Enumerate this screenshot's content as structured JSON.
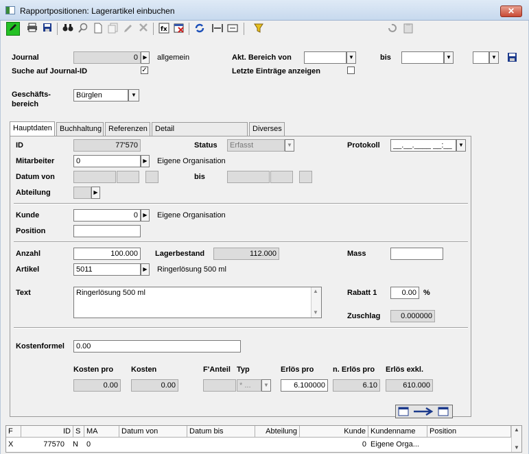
{
  "window": {
    "title": "Rapportpositionen: Lagerartikel einbuchen",
    "close_glyph": "✕"
  },
  "toolbar": {
    "left_icons": [
      "pencil-icon",
      "printer-icon",
      "save-icon",
      "binoculars-icon",
      "zoom-icon",
      "new-page-icon",
      "copy-page-icon",
      "edit-icon",
      "delete-icon",
      "fx-icon",
      "calendar-delete-icon",
      "refresh-icon",
      "resize-icon",
      "fit-icon",
      "filter-funnel-icon"
    ],
    "right_icons": [
      "undo-icon",
      "clipboard-icon"
    ]
  },
  "header": {
    "journal_label": "Journal",
    "journal_value": "0",
    "journal_desc": "allgemein",
    "search_journal_label": "Suche auf Journal-ID",
    "search_journal_checked": true,
    "bereich_von_label": "Akt. Bereich von",
    "bereich_von_value": "",
    "bis_label": "bis",
    "bis_value": "",
    "extra_value": "",
    "last_entries_label": "Letzte Einträge anzeigen",
    "last_entries_checked": false,
    "geschaeft_label_1": "Geschäfts-",
    "geschaeft_label_2": "bereich",
    "geschaeft_value": "Bürglen"
  },
  "tabs": [
    "Hauptdaten",
    "Buchhaltung",
    "Referenzen",
    "Detail Abzug/Teil/Rech'Pos",
    "Diverses"
  ],
  "main": {
    "id_label": "ID",
    "id_value": "77'570",
    "status_label": "Status",
    "status_value": "Erfasst",
    "protokoll_label": "Protokoll",
    "protokoll_value": "__.__.____ __:__",
    "mitarbeiter_label": "Mitarbeiter",
    "mitarbeiter_value": "0",
    "mitarbeiter_desc": "Eigene Organisation",
    "datum_von_label": "Datum von",
    "datum_bis_label": "bis",
    "abteilung_label": "Abteilung",
    "kunde_label": "Kunde",
    "kunde_value": "0",
    "kunde_desc": "Eigene Organisation",
    "position_label": "Position",
    "position_value": "",
    "anzahl_label": "Anzahl",
    "anzahl_value": "100.000",
    "lagerbestand_label": "Lagerbestand",
    "lagerbestand_value": "112.000",
    "mass_label": "Mass",
    "mass_value": "",
    "artikel_label": "Artikel",
    "artikel_value": "5011",
    "artikel_desc": "Ringerlösung 500 ml",
    "text_label": "Text",
    "text_value": "Ringerlösung 500 ml",
    "rabatt_label": "Rabatt 1",
    "rabatt_value": "0.00",
    "rabatt_unit": "%",
    "zuschlag_label": "Zuschlag",
    "zuschlag_value": "0.000000",
    "kostenformel_label": "Kostenformel",
    "kostenformel_value": "0.00",
    "kosten_pro_label": "Kosten pro",
    "kosten_pro_value": "0.00",
    "kosten_label": "Kosten",
    "kosten_value": "0.00",
    "fanteil_label": "F'Anteil",
    "fanteil_value": "",
    "typ_label": "Typ",
    "typ_value": "* ...",
    "erloes_pro_label": "Erlös pro",
    "erloes_pro_value": "6.100000",
    "n_erloes_pro_label": "n. Erlös pro",
    "n_erloes_pro_value": "6.10",
    "erloes_exkl_label": "Erlös exkl.",
    "erloes_exkl_value": "610.000"
  },
  "grid": {
    "columns": [
      "F",
      "ID",
      "S",
      "MA",
      "Datum von",
      "Datum bis",
      "Abteilung",
      "Kunde",
      "Kundenname",
      "Position"
    ],
    "rows": [
      [
        "X",
        "77570",
        "N",
        "0",
        "",
        "",
        "",
        "0",
        "Eigene Orga...",
        ""
      ]
    ]
  },
  "colors": {
    "active_tool": "#24c124",
    "readonly_bg": "#dcdcdc",
    "frame_bg": "#f0f0f0"
  }
}
